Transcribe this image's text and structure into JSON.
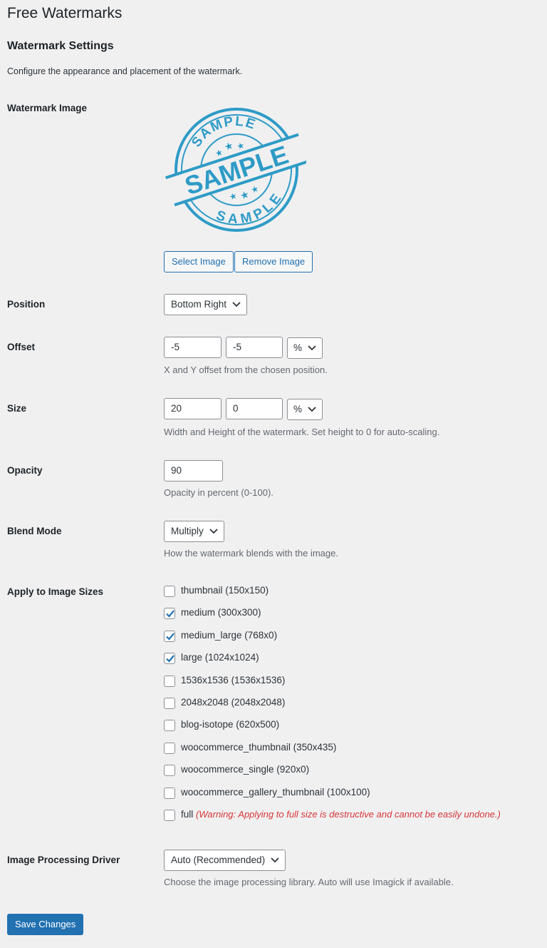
{
  "page_title": "Free Watermarks",
  "section_title": "Watermark Settings",
  "intro": "Configure the appearance and placement of the watermark.",
  "watermark_image": {
    "label": "Watermark Image",
    "stamp_text_top": "SAMPLE",
    "stamp_text_center": "SAMPLE",
    "stamp_text_bottom": "SAMPLE",
    "stamp_color": "#2e9bc6",
    "select_button": "Select Image",
    "remove_button": "Remove Image"
  },
  "position": {
    "label": "Position",
    "value": "Bottom Right"
  },
  "offset": {
    "label": "Offset",
    "x": "-5",
    "y": "-5",
    "unit": "%",
    "description": "X and Y offset from the chosen position."
  },
  "size": {
    "label": "Size",
    "width": "20",
    "height": "0",
    "unit": "%",
    "description": "Width and Height of the watermark. Set height to 0 for auto-scaling."
  },
  "opacity": {
    "label": "Opacity",
    "value": "90",
    "description": "Opacity in percent (0-100)."
  },
  "blend_mode": {
    "label": "Blend Mode",
    "value": "Multiply",
    "description": "How the watermark blends with the image."
  },
  "image_sizes": {
    "label": "Apply to Image Sizes",
    "items": [
      {
        "label": "thumbnail (150x150)",
        "checked": false
      },
      {
        "label": "medium (300x300)",
        "checked": true
      },
      {
        "label": "medium_large (768x0)",
        "checked": true
      },
      {
        "label": "large (1024x1024)",
        "checked": true
      },
      {
        "label": "1536x1536 (1536x1536)",
        "checked": false
      },
      {
        "label": "2048x2048 (2048x2048)",
        "checked": false
      },
      {
        "label": "blog-isotope (620x500)",
        "checked": false
      },
      {
        "label": "woocommerce_thumbnail (350x435)",
        "checked": false
      },
      {
        "label": "woocommerce_single (920x0)",
        "checked": false
      },
      {
        "label": "woocommerce_gallery_thumbnail (100x100)",
        "checked": false
      },
      {
        "label": "full",
        "checked": false,
        "warning": "(Warning: Applying to full size is destructive and cannot be easily undone.)"
      }
    ]
  },
  "driver": {
    "label": "Image Processing Driver",
    "value": "Auto (Recommended)",
    "description": "Choose the image processing library. Auto will use Imagick if available."
  },
  "save_button": "Save Changes",
  "colors": {
    "accent": "#2271b1",
    "warning": "#d63638",
    "background": "#f0f0f1"
  }
}
